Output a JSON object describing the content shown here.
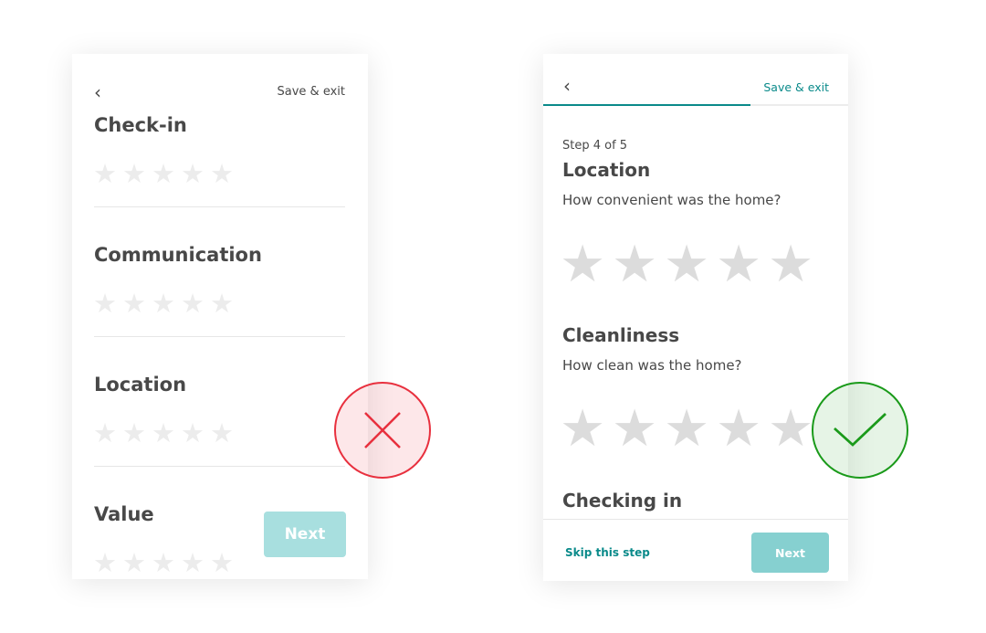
{
  "bad_example": {
    "back_icon": "chevron-left-icon",
    "save_exit": "Save & exit",
    "sections": [
      {
        "title": "Check-in",
        "rating": 0
      },
      {
        "title": "Communication",
        "rating": 0
      },
      {
        "title": "Location",
        "rating": 0
      },
      {
        "title": "Value",
        "rating": 0
      }
    ],
    "next": "Next",
    "verdict_icon": "x-icon",
    "verdict_color": "#e8303e"
  },
  "good_example": {
    "back_icon": "chevron-left-icon",
    "save_exit": "Save & exit",
    "progress": 0.8,
    "step": "Step 4 of 5",
    "sections": [
      {
        "title": "Location",
        "question": "How convenient was the home?",
        "rating": 0
      },
      {
        "title": "Cleanliness",
        "question": "How clean was the home?",
        "rating": 0
      },
      {
        "title": "Checking in"
      }
    ],
    "skip": "Skip this step",
    "next": "Next",
    "verdict_icon": "checkmark-icon",
    "verdict_color": "#1a9a1a",
    "accent": "#0a8a8a"
  }
}
